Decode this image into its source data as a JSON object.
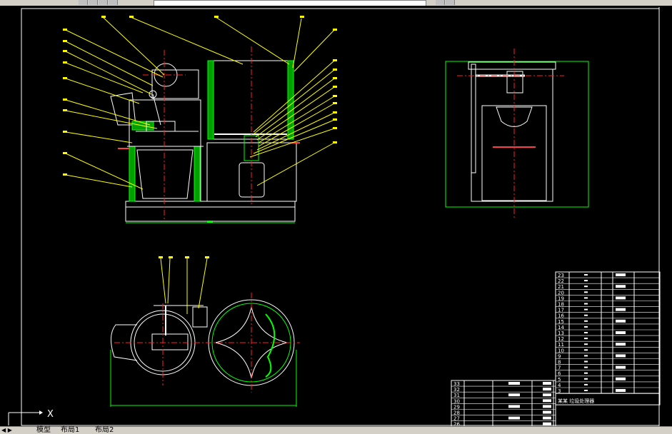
{
  "colors": {
    "background": "#000000",
    "part_outline": "#ffffff",
    "center_line": "#ff2020",
    "leader_line": "#ffff00",
    "dimension": "#00ff00",
    "section_fill": "#00c000"
  },
  "ucs": {
    "x_label": "X"
  },
  "table_bottom": {
    "rows": [
      "33",
      "32",
      "31",
      "30",
      "29",
      "28",
      "27",
      "26"
    ]
  },
  "table_right": {
    "rows": [
      "23",
      "22",
      "21",
      "20",
      "19",
      "18",
      "17",
      "16",
      "15",
      "14",
      "13",
      "12",
      "11",
      "10",
      "9",
      "8",
      "7",
      "6",
      "5",
      "4",
      "3"
    ],
    "footer": "某某 垃圾处理器"
  },
  "tabs": {
    "nav_icons": "◀ ▶",
    "model": "模型",
    "layout1": "布局1",
    "layout2": "布局2"
  }
}
